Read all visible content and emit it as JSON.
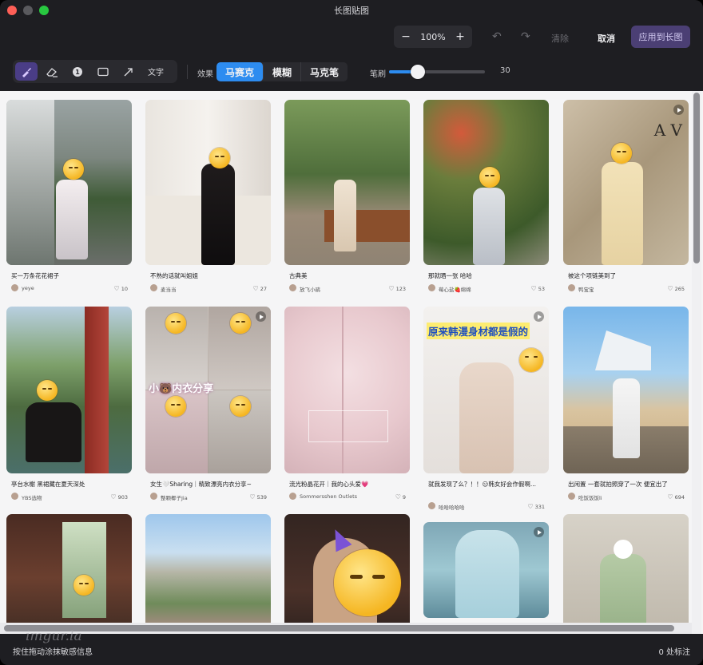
{
  "window": {
    "title": "长图贴图"
  },
  "zoom": {
    "minus": "−",
    "value": "100%",
    "plus": "+"
  },
  "actions": {
    "undo": "↶",
    "redo": "↷",
    "clear": "清除",
    "cancel": "取消",
    "apply": "应用到长图"
  },
  "tools": {
    "step_number": "1",
    "text": "文字"
  },
  "effects": {
    "label": "效果",
    "items": [
      "马赛克",
      "模糊",
      "马克笔"
    ],
    "selected": "马赛克"
  },
  "brush": {
    "label": "笔刷",
    "value": "30",
    "level_fraction": 0.3
  },
  "feed": [
    {
      "caption": "买一万条花花裙子",
      "user": "yeye",
      "likes": "10"
    },
    {
      "caption": "不熟的话就叫姐姐",
      "user": "麦当当",
      "likes": "27"
    },
    {
      "caption": "古典美",
      "user": "放飞小鹃",
      "likes": "123"
    },
    {
      "caption": "那就晒一张 哈哈",
      "user": "莓心盐🍓绵绵",
      "likes": "53"
    },
    {
      "caption": "被这个项链美到了",
      "user": "鸭宝宝",
      "likes": "265"
    },
    {
      "caption": "亭台水榭 黑裙藏在夏天深处",
      "user": "YBS选物",
      "likes": "903"
    },
    {
      "caption": "女生🤍Sharing｜精致漂亮内衣分享~",
      "user": "整颗椰子Jia",
      "likes": "539",
      "overlay": "小🐻内衣分享"
    },
    {
      "caption": "流光粉晶花开｜我的心头爱💗",
      "user": "Sommersshen Outlets",
      "likes": "9"
    },
    {
      "caption": "就我发现了么？！！😑韩女好会作假啊...",
      "user": "哈哈哈哈哈",
      "likes": "331",
      "overlay": "原来韩漫身材都是假的"
    },
    {
      "caption": "出闲置 一套就拍照穿了一次 便宜出了",
      "user": "吃饭饭饭li",
      "likes": "694"
    },
    {
      "caption": "",
      "user": "",
      "likes": ""
    },
    {
      "caption": "",
      "user": "",
      "likes": ""
    },
    {
      "caption": "",
      "user": "",
      "likes": ""
    },
    {
      "caption": "",
      "user": "",
      "likes": ""
    },
    {
      "caption": "",
      "user": "",
      "likes": ""
    }
  ],
  "photo_text": {
    "wall_letters": "A V"
  },
  "status": {
    "hint": "按住拖动涂抹敏感信息",
    "count": "0 处标注"
  },
  "watermark": "imgur.la"
}
